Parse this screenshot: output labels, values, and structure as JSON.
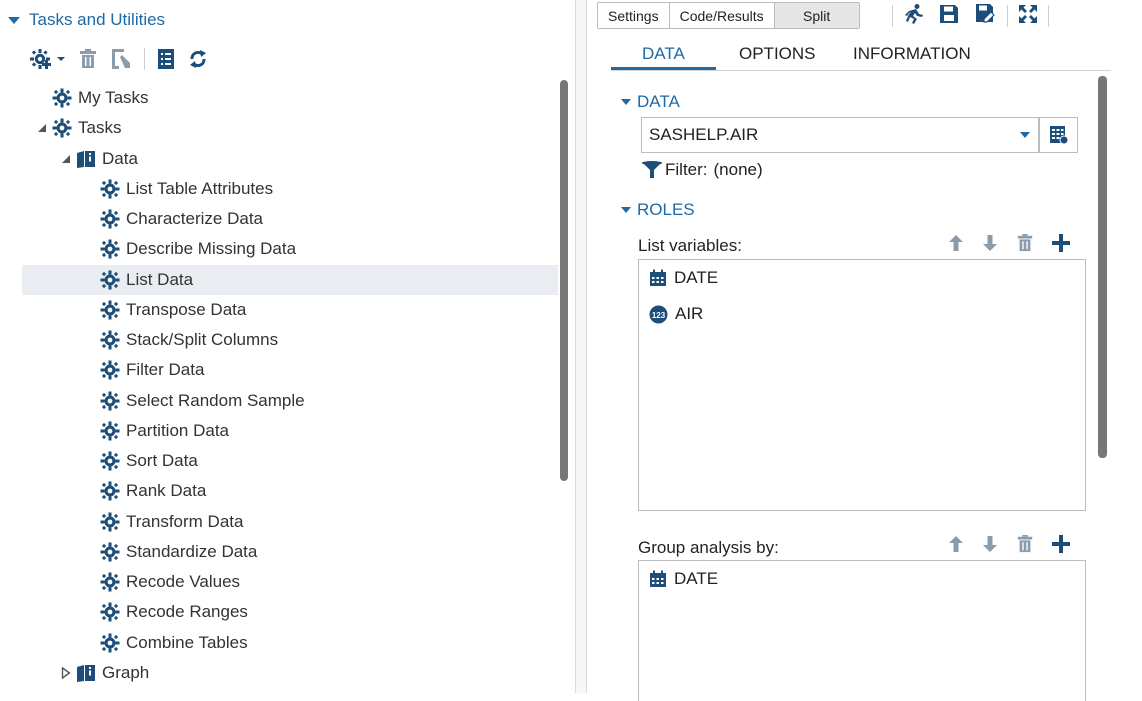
{
  "left": {
    "section_title": "Tasks and Utilities",
    "tree": [
      {
        "label": "My Tasks",
        "level": 0,
        "twisty": "none",
        "icon": "task-icon"
      },
      {
        "label": "Tasks",
        "level": 0,
        "twisty": "open",
        "icon": "task-icon"
      },
      {
        "label": "Data",
        "level": 1,
        "twisty": "open",
        "icon": "folder-book-icon"
      },
      {
        "label": "List Table Attributes",
        "level": 2,
        "twisty": "none",
        "icon": "task-icon"
      },
      {
        "label": "Characterize Data",
        "level": 2,
        "twisty": "none",
        "icon": "task-icon"
      },
      {
        "label": "Describe Missing Data",
        "level": 2,
        "twisty": "none",
        "icon": "task-icon"
      },
      {
        "label": "List Data",
        "level": 2,
        "twisty": "none",
        "icon": "task-icon",
        "selected": true
      },
      {
        "label": "Transpose Data",
        "level": 2,
        "twisty": "none",
        "icon": "task-icon"
      },
      {
        "label": "Stack/Split Columns",
        "level": 2,
        "twisty": "none",
        "icon": "task-icon"
      },
      {
        "label": "Filter Data",
        "level": 2,
        "twisty": "none",
        "icon": "task-icon"
      },
      {
        "label": "Select Random Sample",
        "level": 2,
        "twisty": "none",
        "icon": "task-icon"
      },
      {
        "label": "Partition Data",
        "level": 2,
        "twisty": "none",
        "icon": "task-icon"
      },
      {
        "label": "Sort Data",
        "level": 2,
        "twisty": "none",
        "icon": "task-icon"
      },
      {
        "label": "Rank Data",
        "level": 2,
        "twisty": "none",
        "icon": "task-icon"
      },
      {
        "label": "Transform Data",
        "level": 2,
        "twisty": "none",
        "icon": "task-icon"
      },
      {
        "label": "Standardize Data",
        "level": 2,
        "twisty": "none",
        "icon": "task-icon"
      },
      {
        "label": "Recode Values",
        "level": 2,
        "twisty": "none",
        "icon": "task-icon"
      },
      {
        "label": "Recode Ranges",
        "level": 2,
        "twisty": "none",
        "icon": "task-icon"
      },
      {
        "label": "Combine Tables",
        "level": 2,
        "twisty": "none",
        "icon": "task-icon"
      },
      {
        "label": "Graph",
        "level": 1,
        "twisty": "closed",
        "icon": "folder-book-icon"
      }
    ]
  },
  "right": {
    "view_buttons": [
      "Settings",
      "Code/Results",
      "Split"
    ],
    "tabs": [
      "DATA",
      "OPTIONS",
      "INFORMATION"
    ],
    "active_tab": "DATA",
    "data_section": "DATA",
    "dataset": "SASHELP.AIR",
    "filter_label": "Filter:",
    "filter_value": "(none)",
    "roles_section": "ROLES",
    "list_variables_label": "List variables:",
    "list_variables": [
      {
        "name": "DATE",
        "icon": "calendar-icon"
      },
      {
        "name": "AIR",
        "icon": "numeric-123-icon"
      }
    ],
    "group_by_label": "Group analysis by:",
    "group_variables": [
      {
        "name": "DATE",
        "icon": "calendar-icon"
      }
    ]
  },
  "colors": {
    "accent": "#1f6aa5",
    "icon": "#1d4e79",
    "selected_row": "#e9ecf0"
  }
}
